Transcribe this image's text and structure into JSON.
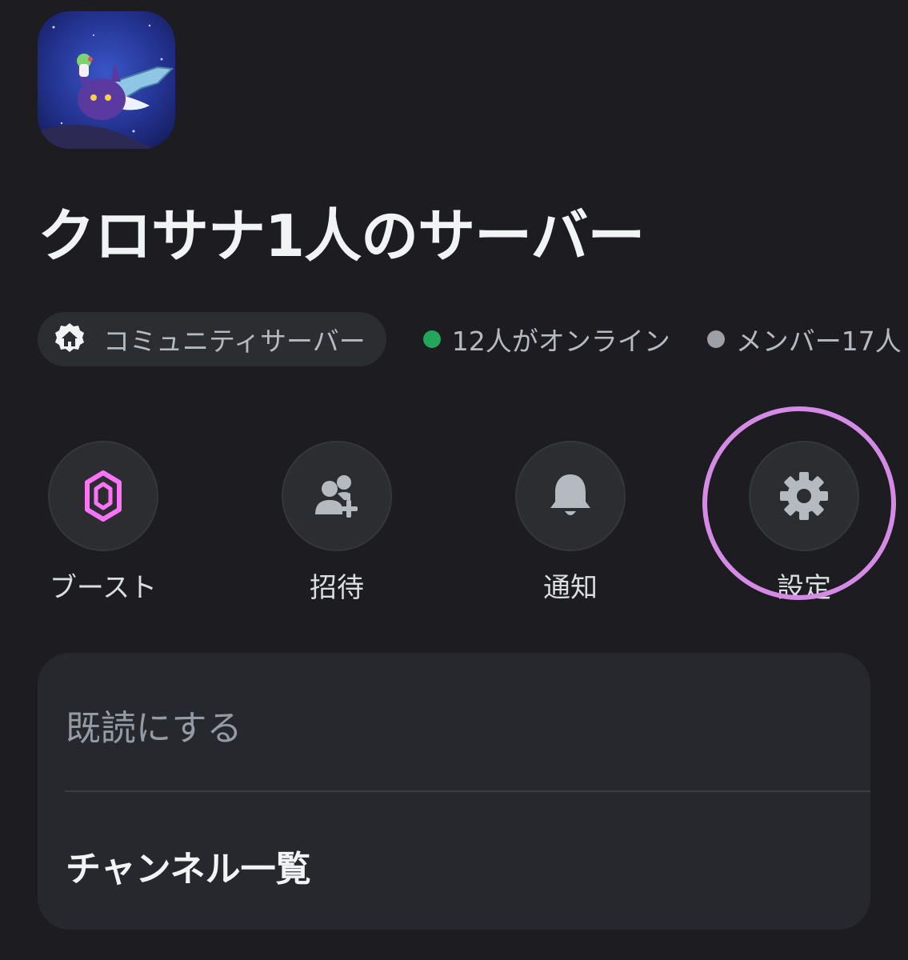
{
  "server": {
    "name": "クロサナ1人のサーバー",
    "icon": "server-avatar-image"
  },
  "info": {
    "community_label": "コミュニティサーバー",
    "community_icon": "home-icon",
    "online_text": "12人がオンライン",
    "online_color": "#23a55a",
    "members_text": "メンバー17人",
    "members_color": "#9da0a6"
  },
  "actions": [
    {
      "label": "ブースト",
      "icon": "boost-gem-icon",
      "color": "#ff73fa"
    },
    {
      "label": "招待",
      "icon": "invite-user-icon",
      "color": "#b5bac1"
    },
    {
      "label": "通知",
      "icon": "bell-icon",
      "color": "#b5bac1"
    },
    {
      "label": "設定",
      "icon": "gear-icon",
      "color": "#b5bac1"
    }
  ],
  "highlight_color": "#d58be6",
  "menu": {
    "mark_read": "既読にする",
    "channel_list": "チャンネル一覧"
  }
}
